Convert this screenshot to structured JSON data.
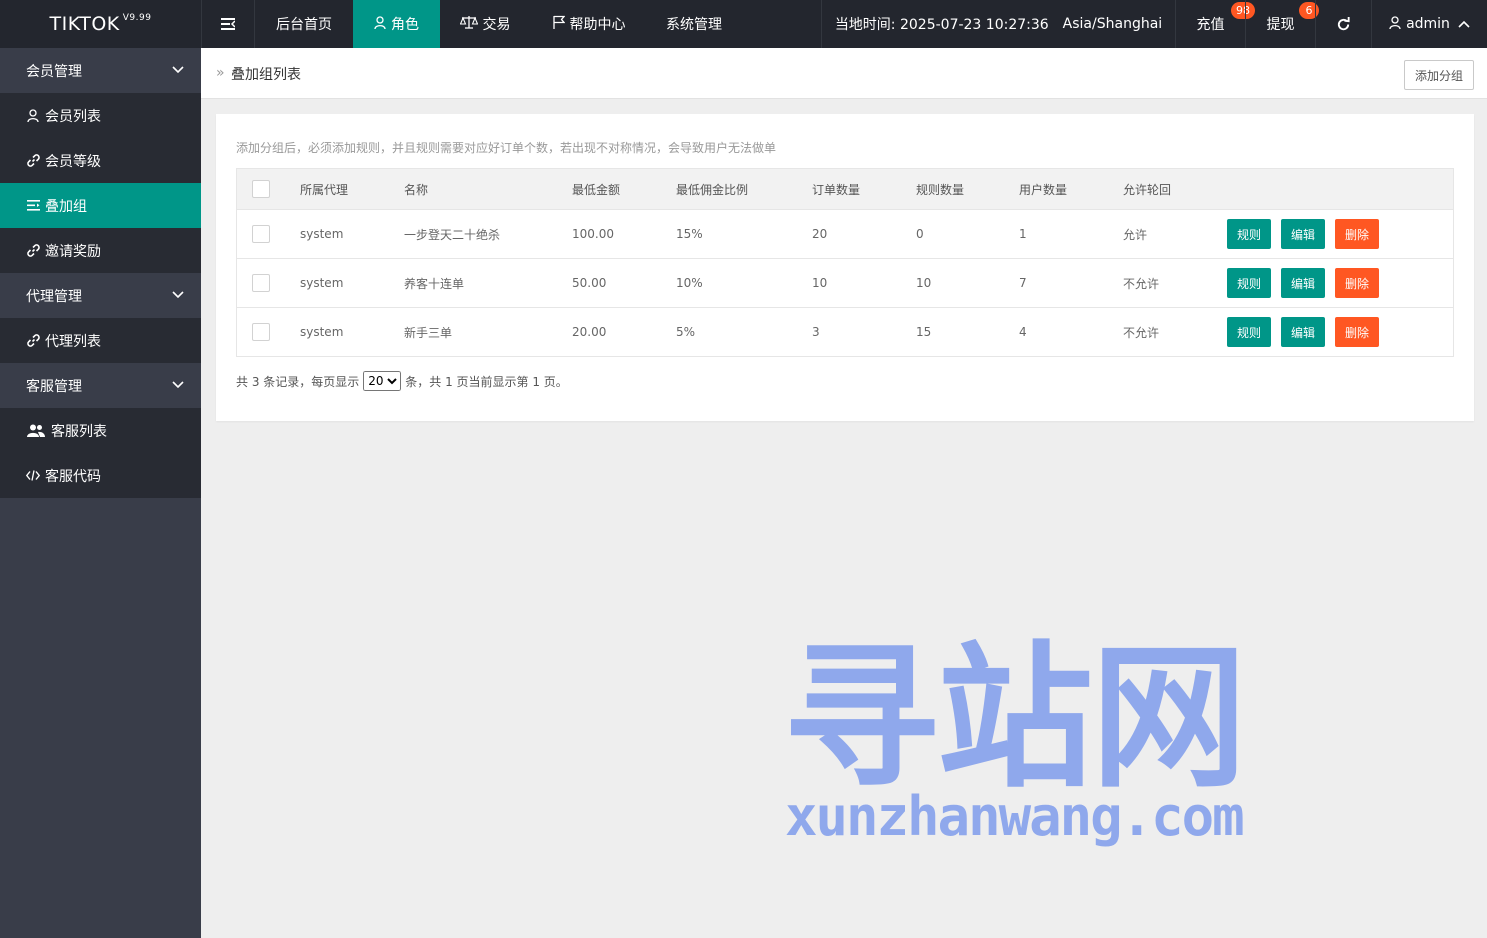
{
  "header": {
    "logo": "TIKTOK",
    "version": "V9.99",
    "nav": [
      {
        "label": "后台首页"
      },
      {
        "label": "角色",
        "active": true
      },
      {
        "label": "交易"
      },
      {
        "label": "帮助中心"
      },
      {
        "label": "系统管理"
      }
    ],
    "time_text": "当地时间: 2025-07-23 10:27:36",
    "timezone": "Asia/Shanghai",
    "recharge": {
      "label": "充值",
      "badge": "98"
    },
    "withdraw": {
      "label": "提现",
      "badge": "6"
    },
    "user": "admin"
  },
  "sidebar": {
    "groups": [
      {
        "label": "会员管理",
        "items": [
          {
            "label": "会员列表",
            "icon": "user-icon"
          },
          {
            "label": "会员等级",
            "icon": "link-icon"
          },
          {
            "label": "叠加组",
            "icon": "list-icon",
            "active": true
          },
          {
            "label": "邀请奖励",
            "icon": "link-icon"
          }
        ]
      },
      {
        "label": "代理管理",
        "items": [
          {
            "label": "代理列表",
            "icon": "link-icon"
          }
        ]
      },
      {
        "label": "客服管理",
        "items": [
          {
            "label": "客服列表",
            "icon": "users-icon"
          },
          {
            "label": "客服代码",
            "icon": "code-icon"
          }
        ]
      }
    ]
  },
  "breadcrumb": {
    "current": "叠加组列表",
    "add_button": "添加分组"
  },
  "content": {
    "tip": "添加分组后，必须添加规则，并且规则需要对应好订单个数，若出现不对称情况，会导致用户无法做单",
    "columns": [
      "所属代理",
      "名称",
      "最低金额",
      "最低佣金比例",
      "订单数量",
      "规则数量",
      "用户数量",
      "允许轮回"
    ],
    "rows": [
      {
        "agent": "system",
        "name": "一步登天二十绝杀",
        "min_amount": "100.00",
        "min_rate": "15%",
        "orders": "20",
        "rules": "0",
        "users": "1",
        "loop": "允许"
      },
      {
        "agent": "system",
        "name": "养客十连单",
        "min_amount": "50.00",
        "min_rate": "10%",
        "orders": "10",
        "rules": "10",
        "users": "7",
        "loop": "不允许"
      },
      {
        "agent": "system",
        "name": "新手三单",
        "min_amount": "20.00",
        "min_rate": "5%",
        "orders": "3",
        "rules": "15",
        "users": "4",
        "loop": "不允许"
      }
    ],
    "actions": {
      "rule": "规则",
      "edit": "编辑",
      "delete": "删除"
    },
    "pager": {
      "prefix": "共 3 条记录，每页显示",
      "page_size": "20",
      "suffix": "条，共 1 页当前显示第 1 页。"
    }
  },
  "watermark": {
    "cn": "寻站网",
    "en": "xunzhanwang.com"
  },
  "colors": {
    "accent": "#009688",
    "danger": "#ff5722",
    "header_bg": "#23262e",
    "sidebar_bg": "#393d49"
  }
}
